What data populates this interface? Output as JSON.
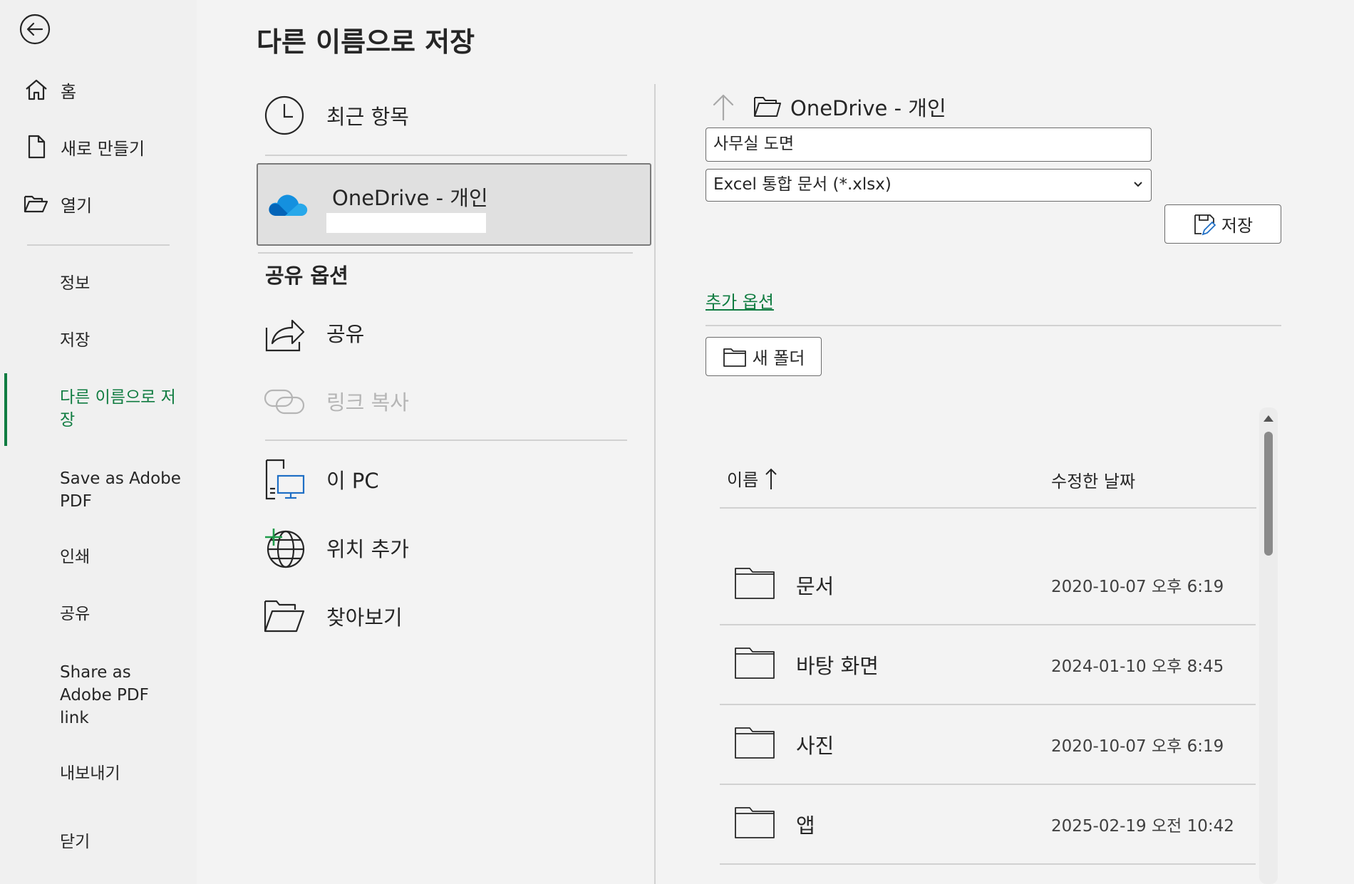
{
  "title": "다른 이름으로 저장",
  "nav": {
    "back_icon": "back-arrow-icon",
    "top_items": [
      {
        "label": "홈",
        "icon": "home-icon"
      },
      {
        "label": "새로 만들기",
        "icon": "new-document-icon"
      },
      {
        "label": "열기",
        "icon": "open-folder-icon"
      }
    ],
    "items": [
      {
        "label": "정보",
        "selected": false
      },
      {
        "label": "저장",
        "selected": false
      },
      {
        "label": "다른 이름으로 저장",
        "selected": true
      },
      {
        "label": "Save as Adobe PDF",
        "selected": false
      },
      {
        "label": "인쇄",
        "selected": false
      },
      {
        "label": "공유",
        "selected": false
      },
      {
        "label": "Share as Adobe PDF link",
        "selected": false
      },
      {
        "label": "내보내기",
        "selected": false
      },
      {
        "label": "닫기",
        "selected": false
      }
    ]
  },
  "places": {
    "recent": "최근 항목",
    "onedrive": "OneDrive - 개인",
    "share_header": "공유 옵션",
    "share": "공유",
    "copy_link": "링크 복사",
    "this_pc": "이 PC",
    "add_location": "위치 추가",
    "browse": "찾아보기"
  },
  "save_panel": {
    "location": "OneDrive - 개인",
    "filename": "사무실 도면",
    "filetype": "Excel 통합 문서 (*.xlsx)",
    "save_button": "저장",
    "more_options": "추가 옵션",
    "new_folder": "새 폴더"
  },
  "file_list": {
    "columns": {
      "name": "이름",
      "date": "수정한 날짜"
    },
    "sort": "ascending",
    "rows": [
      {
        "name": "문서",
        "date": "2020-10-07 오후 6:19"
      },
      {
        "name": "바탕 화면",
        "date": "2024-01-10 오후 8:45"
      },
      {
        "name": "사진",
        "date": "2020-10-07 오후 6:19"
      },
      {
        "name": "앱",
        "date": "2025-02-19 오전 10:42"
      }
    ]
  },
  "colors": {
    "accent": "#107c41",
    "background": "#f3f3f3",
    "selected_tile": "#e0e0e0"
  }
}
